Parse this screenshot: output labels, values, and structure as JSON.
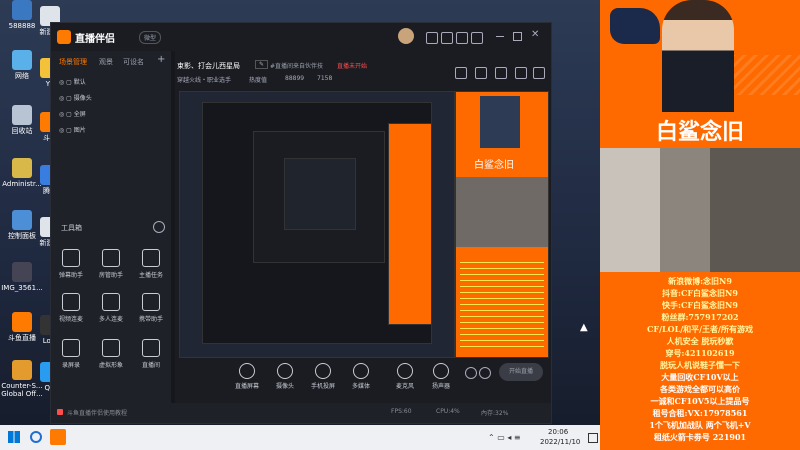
{
  "desktop": {
    "icons": [
      {
        "label": "588888"
      },
      {
        "label": "新建文"
      },
      {
        "label": "网络"
      },
      {
        "label": "回收站"
      },
      {
        "label": "Administr..."
      },
      {
        "label": "控制面板"
      },
      {
        "label": "IMG_3561..."
      },
      {
        "label": "斗鱼直播"
      },
      {
        "label": "Counter-S... Global Off..."
      },
      {
        "label": "YY"
      },
      {
        "label": "斗鱼"
      },
      {
        "label": "腾讯"
      },
      {
        "label": "新建文"
      },
      {
        "label": "Logi"
      },
      {
        "label": "QQ"
      },
      {
        "label": "直播伴侣"
      }
    ]
  },
  "app": {
    "title": "直播伴侣",
    "badge": "微型",
    "left_tabs": [
      "场景管理",
      "观景",
      "可设名"
    ],
    "scenes": [
      {
        "label": "默认"
      },
      {
        "label": "摄像头"
      },
      {
        "label": "全屏"
      },
      {
        "label": "图片"
      }
    ],
    "toolbox_label": "工具箱",
    "tools": [
      {
        "label": "弹幕助手"
      },
      {
        "label": "房管助手"
      },
      {
        "label": "主播任务"
      },
      {
        "label": "视频连麦"
      },
      {
        "label": "多人连麦"
      },
      {
        "label": "携带助手"
      },
      {
        "label": "录屏录"
      },
      {
        "label": "虚拟形象"
      },
      {
        "label": "直播间"
      }
    ],
    "stream_title": "束影、打会儿西星局",
    "stream_tag": "#直播间来自伙伴技",
    "stream_status": "直播未开始",
    "category": "穿越火线・职业选手",
    "viewer_label": "热度值",
    "stats": [
      "88899",
      "7158"
    ],
    "bottom_buttons": [
      {
        "label": "直播屏幕"
      },
      {
        "label": "摄像头"
      },
      {
        "label": "手机投屏"
      },
      {
        "label": "多媒体"
      },
      {
        "label": "麦克风"
      },
      {
        "label": "扬声器"
      }
    ],
    "start_button": "开始直播",
    "status_text": "斗鱼直播伴侣使用教程",
    "fps_labels": [
      "FPS:60",
      "CPU:4%",
      "內存:32%"
    ]
  },
  "taskbar": {
    "time": "20:06",
    "date": "2022/11/10",
    "pinned": [
      "windows-logo",
      "search-icon",
      "app-icon"
    ]
  },
  "stream": {
    "streamer_name": "白鲨念旧",
    "info_lines": [
      "新浪微博:念旧N9",
      "抖音:CF白鲨念旧N9",
      "快手:CF白鲨念旧N9",
      "粉丝群:757917202",
      "CF/LOL/和平/王者/所有游戏",
      "人机安全 脱玩秒歉",
      "穿号:421102619",
      "脱玩人机说鞋子懂一下",
      "大量回收CF10V以上",
      "各类游戏全都可以高价",
      "一诚和CF10V5以上提品号",
      "租号合租:VX:17978561",
      "1个飞机加战队 两个飞机+V",
      "租纸火箭卡劵号 221901"
    ]
  }
}
